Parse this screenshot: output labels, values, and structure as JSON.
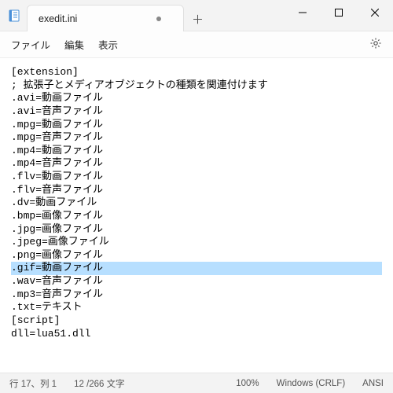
{
  "titlebar": {
    "tab_title": "exedit.ini",
    "dirty": true
  },
  "menu": {
    "file": "ファイル",
    "edit": "編集",
    "view": "表示"
  },
  "editor": {
    "lines": [
      {
        "text": "[extension]",
        "sel": false
      },
      {
        "text": "; 拡張子とメディアオブジェクトの種類を関連付けます",
        "sel": false
      },
      {
        "text": ".avi=動画ファイル",
        "sel": false
      },
      {
        "text": ".avi=音声ファイル",
        "sel": false
      },
      {
        "text": ".mpg=動画ファイル",
        "sel": false
      },
      {
        "text": ".mpg=音声ファイル",
        "sel": false
      },
      {
        "text": ".mp4=動画ファイル",
        "sel": false
      },
      {
        "text": ".mp4=音声ファイル",
        "sel": false
      },
      {
        "text": ".flv=動画ファイル",
        "sel": false
      },
      {
        "text": ".flv=音声ファイル",
        "sel": false
      },
      {
        "text": ".dv=動画ファイル",
        "sel": false
      },
      {
        "text": ".bmp=画像ファイル",
        "sel": false
      },
      {
        "text": ".jpg=画像ファイル",
        "sel": false
      },
      {
        "text": ".jpeg=画像ファイル",
        "sel": false
      },
      {
        "text": ".png=画像ファイル",
        "sel": false
      },
      {
        "text": ".gif=動画ファイル",
        "sel": true
      },
      {
        "text": ".wav=音声ファイル",
        "sel": false
      },
      {
        "text": ".mp3=音声ファイル",
        "sel": false
      },
      {
        "text": ".txt=テキスト",
        "sel": false
      },
      {
        "text": "",
        "sel": false
      },
      {
        "text": "[script]",
        "sel": false
      },
      {
        "text": "dll=lua51.dll",
        "sel": false
      }
    ]
  },
  "status": {
    "cursor": "行 17、列 1",
    "selection": "12 /266 文字",
    "zoom": "100%",
    "eol": "Windows (CRLF)",
    "encoding": "ANSI"
  }
}
